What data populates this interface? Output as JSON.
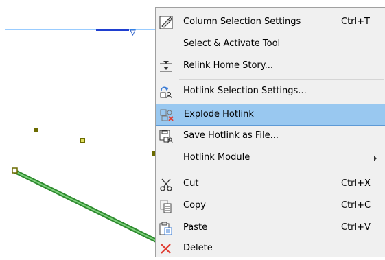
{
  "colors": {
    "menu_bg": "#f0f0f0",
    "highlight_bg": "#99c8f0",
    "highlight_border": "#5e9ad6",
    "story_line": "#3399ff",
    "wall_green": "#3cb371",
    "node_olive": "#6b6b00",
    "delete_red": "#e03c31"
  },
  "context_menu": {
    "items": [
      {
        "label": "Column Selection Settings",
        "shortcut": "Ctrl+T",
        "icon": "column-settings-icon"
      },
      {
        "label": "Select & Activate Tool",
        "shortcut": "",
        "icon": ""
      },
      {
        "label": "Relink Home Story...",
        "shortcut": "",
        "icon": "relink-story-icon"
      },
      {
        "label": "Hotlink Selection Settings...",
        "shortcut": "",
        "icon": "hotlink-settings-icon"
      },
      {
        "label": "Explode Hotlink",
        "shortcut": "",
        "icon": "explode-hotlink-icon"
      },
      {
        "label": "Save Hotlink as File...",
        "shortcut": "",
        "icon": "save-hotlink-icon"
      },
      {
        "label": "Hotlink Module",
        "shortcut": "",
        "icon": ""
      },
      {
        "label": "Cut",
        "shortcut": "Ctrl+X",
        "icon": "cut-icon"
      },
      {
        "label": "Copy",
        "shortcut": "Ctrl+C",
        "icon": "copy-icon"
      },
      {
        "label": "Paste",
        "shortcut": "Ctrl+V",
        "icon": "paste-icon"
      },
      {
        "label": "Delete",
        "shortcut": "",
        "icon": "delete-icon"
      }
    ],
    "highlighted_item": "Explode Hotlink"
  }
}
